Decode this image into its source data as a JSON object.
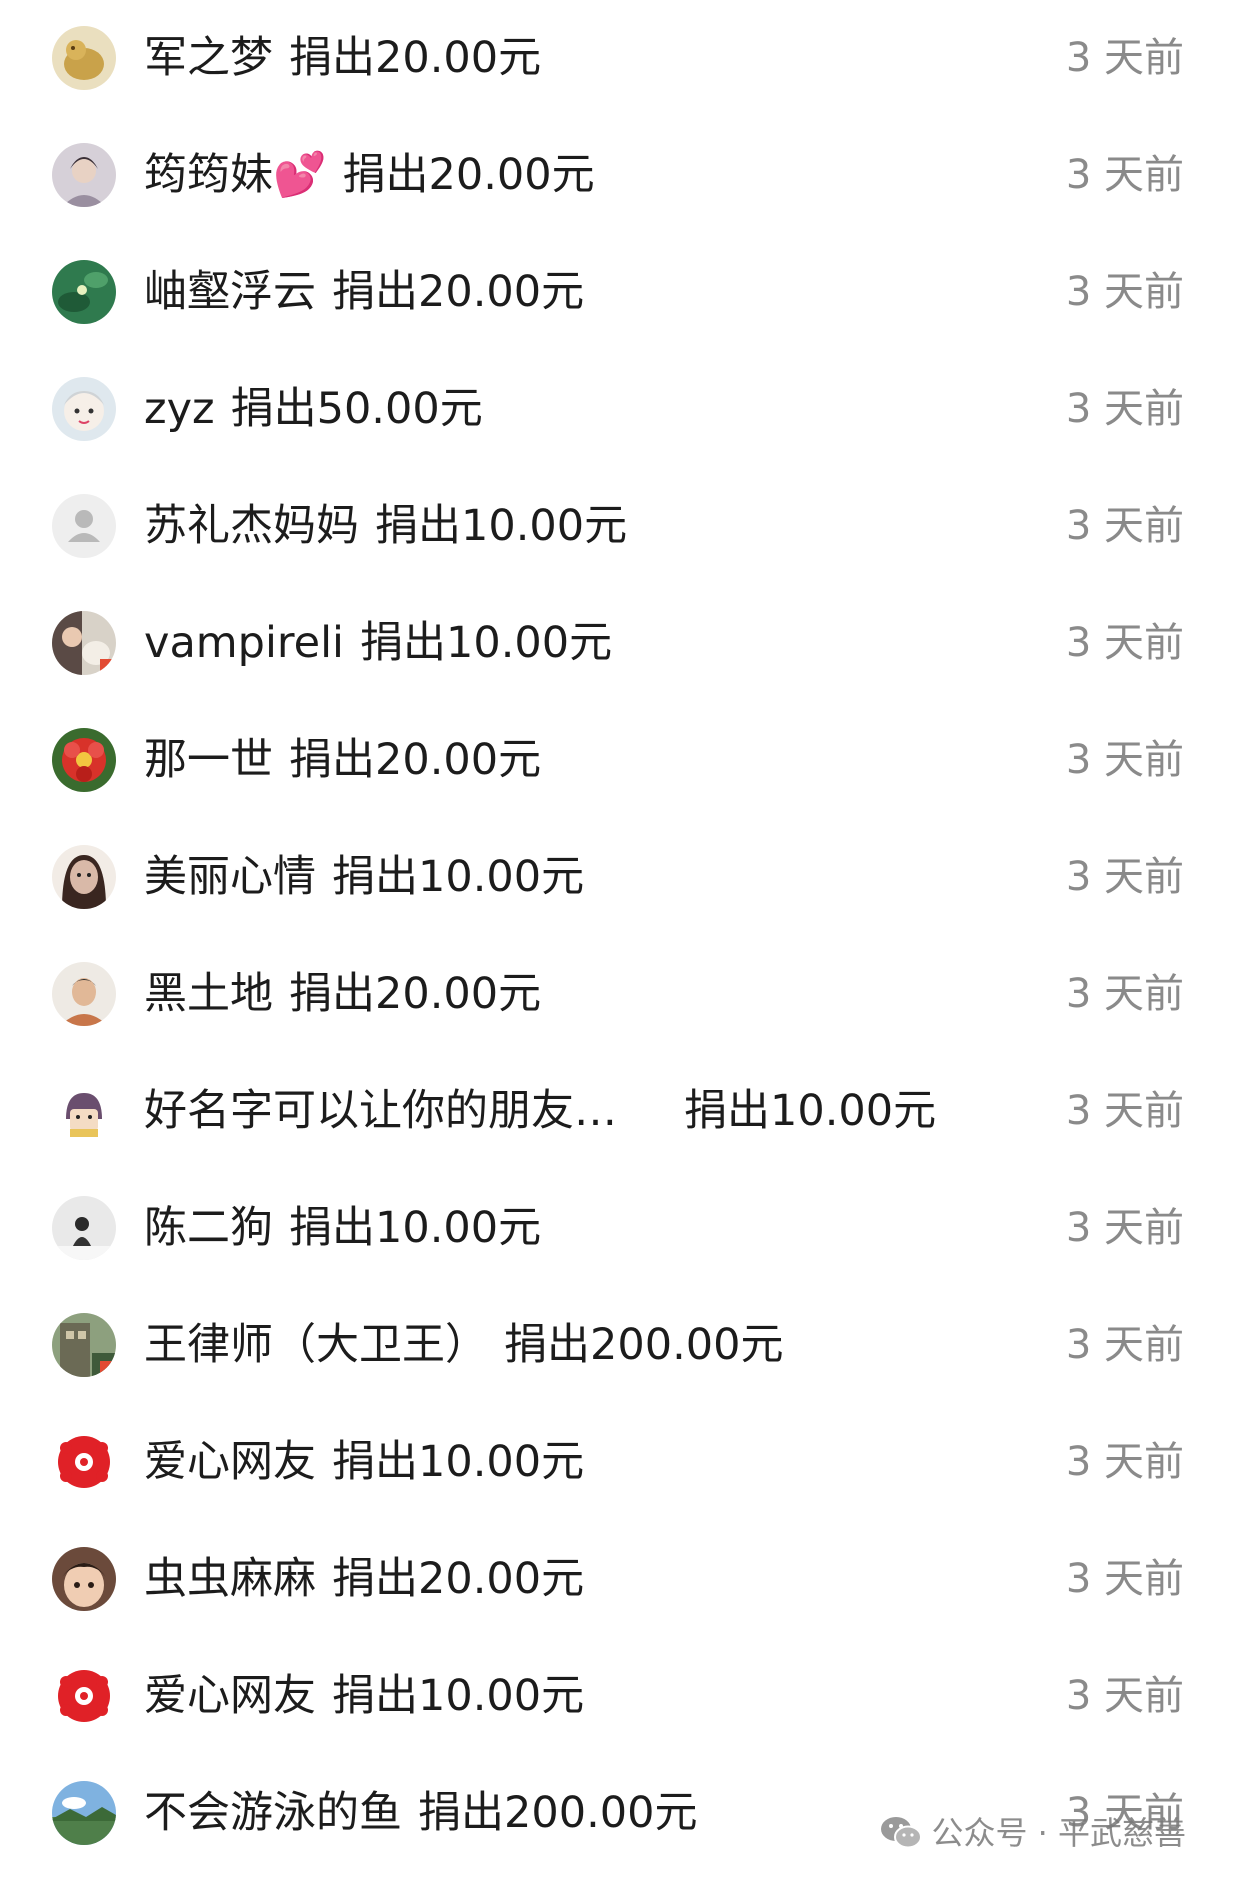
{
  "donations": [
    {
      "name": "军之梦",
      "amount": "捐出20.00元",
      "time": "3 天前",
      "avatar": "gold-figurine-avatar",
      "avatar_color": "#c9a24a"
    },
    {
      "name": "筠筠妹💕",
      "amount": "捐出20.00元",
      "time": "3 天前",
      "avatar": "person-photo-avatar",
      "avatar_color": "#9a8fa0"
    },
    {
      "name": "岫壑浮云",
      "amount": "捐出20.00元",
      "time": "3 天前",
      "avatar": "green-pond-avatar",
      "avatar_color": "#2f7a4e"
    },
    {
      "name": "zyz",
      "amount": "捐出50.00元",
      "time": "3 天前",
      "avatar": "white-face-avatar",
      "avatar_color": "#e8e4dc"
    },
    {
      "name": "苏礼杰妈妈",
      "amount": "捐出10.00元",
      "time": "3 天前",
      "avatar": "default-user-avatar",
      "avatar_color": "#e6e6e6"
    },
    {
      "name": "vampireli",
      "amount": "捐出10.00元",
      "time": "3 天前",
      "avatar": "woman-with-dog-avatar",
      "avatar_color": "#5a4a45"
    },
    {
      "name": "那一世",
      "amount": "捐出20.00元",
      "time": "3 天前",
      "avatar": "red-flower-avatar",
      "avatar_color": "#d8322a"
    },
    {
      "name": "美丽心情",
      "amount": "捐出10.00元",
      "time": "3 天前",
      "avatar": "woman-portrait-avatar",
      "avatar_color": "#d9b9a8"
    },
    {
      "name": "黑土地",
      "amount": "捐出20.00元",
      "time": "3 天前",
      "avatar": "man-portrait-avatar",
      "avatar_color": "#d8cfc6"
    },
    {
      "name": "好名字可以让你的朋友…",
      "amount": "捐出10.00元",
      "time": "3 天前",
      "avatar": "cartoon-character-avatar",
      "avatar_color": "#f1ece6",
      "truncated": true
    },
    {
      "name": "陈二狗",
      "amount": "捐出10.00元",
      "time": "3 天前",
      "avatar": "person-in-snow-avatar",
      "avatar_color": "#e9e9e9"
    },
    {
      "name": "王律师（大卫王）",
      "amount": "捐出200.00元",
      "time": "3 天前",
      "avatar": "building-photo-avatar",
      "avatar_color": "#6b6a55"
    },
    {
      "name": "爱心网友",
      "amount": "捐出10.00元",
      "time": "3 天前",
      "avatar": "red-charity-avatar",
      "avatar_color": "#e02127"
    },
    {
      "name": "虫虫麻麻",
      "amount": "捐出20.00元",
      "time": "3 天前",
      "avatar": "child-face-avatar",
      "avatar_color": "#6b4a3b"
    },
    {
      "name": "爱心网友",
      "amount": "捐出10.00元",
      "time": "3 天前",
      "avatar": "red-charity-avatar",
      "avatar_color": "#e02127"
    },
    {
      "name": "不会游泳的鱼",
      "amount": "捐出200.00元",
      "time": "3 天前",
      "avatar": "landscape-avatar",
      "avatar_color": "#4f7f4a"
    }
  ],
  "watermark": {
    "icon": "wechat-icon",
    "text": "公众号 · 平武慈善"
  }
}
